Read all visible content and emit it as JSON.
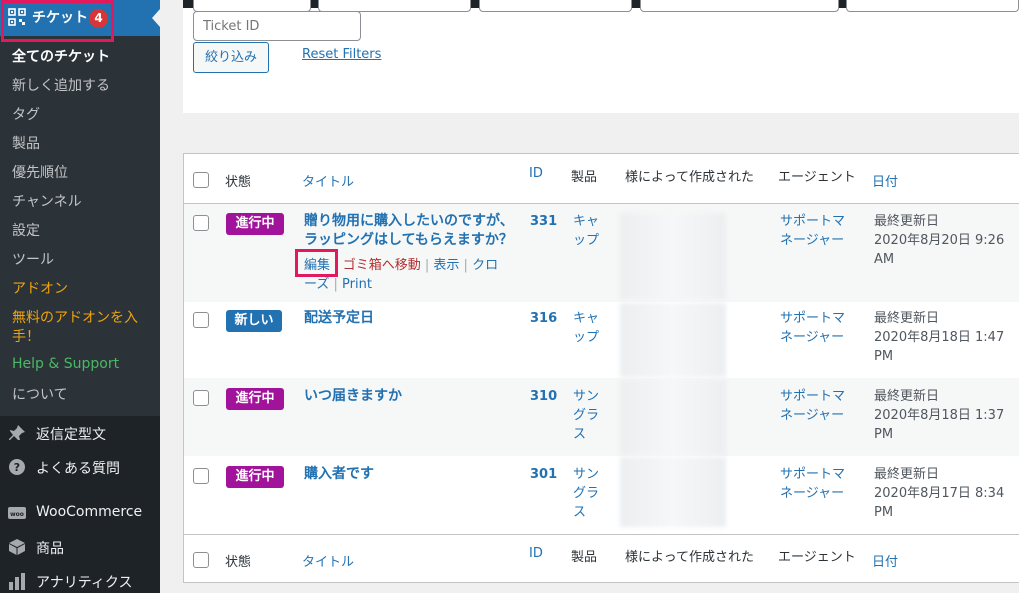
{
  "sidebar": {
    "top": {
      "label": "チケット",
      "badge": "4",
      "icon": "ticket-grid-icon"
    },
    "submenu": [
      "全てのチケット",
      "新しく追加する",
      "タグ",
      "製品",
      "優先順位",
      "チャンネル",
      "設定",
      "ツール",
      "アドオン",
      "無料のアドオンを入",
      "手！",
      "Help & Support",
      "について"
    ],
    "menus": [
      {
        "label": "返信定型文",
        "icon": "pin-icon"
      },
      {
        "label": "よくある質問",
        "icon": "question-icon"
      },
      {
        "label": "WooCommerce",
        "icon": "woo-icon"
      },
      {
        "label": "商品",
        "icon": "box-icon"
      },
      {
        "label": "アナリティクス",
        "icon": "chart-icon"
      }
    ]
  },
  "filters": {
    "ticket_id_placeholder": "Ticket ID",
    "filter_button": "絞り込み",
    "reset_link": "Reset Filters"
  },
  "table": {
    "headers": {
      "status": "状態",
      "title": "タイトル",
      "id": "ID",
      "product": "製品",
      "created_by": "様によって作成された",
      "agent": "エージェント",
      "date": "日付"
    },
    "rows": [
      {
        "status": "進行中",
        "status_type": "progress",
        "title1": "贈り物用に購入したいのですが、",
        "title2": "ラッピングはしてもらえますか？",
        "id": "331",
        "product1": "キャ",
        "product2": "ップ",
        "product3": "",
        "agent1": "サポートマ",
        "agent2": "ネージャー",
        "date1": "最終更新日",
        "date2": "2020年8月20日 9:26",
        "date3": "AM"
      },
      {
        "status": "新しい",
        "status_type": "new",
        "title1": "配送予定日",
        "title2": "",
        "id": "316",
        "product1": "キャ",
        "product2": "ップ",
        "product3": "",
        "agent1": "サポートマ",
        "agent2": "ネージャー",
        "date1": "最終更新日",
        "date2": "2020年8月18日 1:47",
        "date3": "PM"
      },
      {
        "status": "進行中",
        "status_type": "progress",
        "title1": "いつ届きますか",
        "title2": "",
        "id": "310",
        "product1": "サン",
        "product2": "グラ",
        "product3": "ス",
        "agent1": "サポートマ",
        "agent2": "ネージャー",
        "date1": "最終更新日",
        "date2": "2020年8月18日 1:37",
        "date3": "PM"
      },
      {
        "status": "進行中",
        "status_type": "progress",
        "title1": "購入者です",
        "title2": "",
        "id": "301",
        "product1": "サン",
        "product2": "グラ",
        "product3": "ス",
        "agent1": "サポートマ",
        "agent2": "ネージャー",
        "date1": "最終更新日",
        "date2": "2020年8月17日 8:34",
        "date3": "PM"
      }
    ],
    "row_actions": {
      "edit": "編集",
      "trash": "ゴミ箱へ移動",
      "view": "表示",
      "close1": "クロ",
      "close2": "ーズ",
      "print": "Print",
      "sep": "|"
    }
  },
  "colors": {
    "accent": "#2271b1",
    "progress": "#a0139a",
    "highlight": "#e3195d",
    "sidebar": "#1d2327"
  }
}
